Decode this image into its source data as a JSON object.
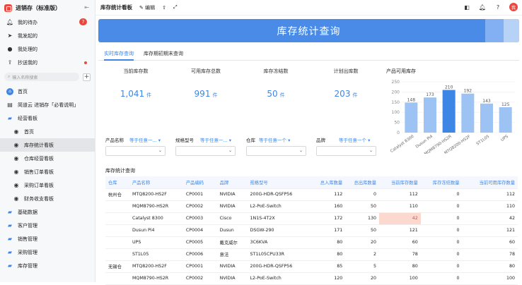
{
  "sidebar": {
    "brand": "进销存（标准版）",
    "items": [
      {
        "label": "我的待办",
        "badge": "7"
      },
      {
        "label": "我发起的"
      },
      {
        "label": "我处理的"
      },
      {
        "label": "抄送我的"
      }
    ],
    "search_placeholder": "输入名称搜索",
    "tree": {
      "home": "首页",
      "guide": "简道云 进销存「必看说明」",
      "board": "经营看板",
      "board_children": [
        "首页",
        "库存统计看板",
        "仓库经营看板",
        "销售订单看板",
        "采购订单看板",
        "财务收支看板"
      ],
      "folders": [
        "基础数据",
        "客户管理",
        "销售管理",
        "采购管理",
        "库存管理"
      ]
    }
  },
  "topbar": {
    "title": "库存统计看板",
    "edit": "编辑"
  },
  "banner": {
    "title": "库存统计查询"
  },
  "tabs": [
    "实时库存查询",
    "库存期初期末查询"
  ],
  "kpis": [
    {
      "label": "当前库存数",
      "value": "1,041",
      "unit": "件"
    },
    {
      "label": "可用库存总数",
      "value": "991",
      "unit": "件"
    },
    {
      "label": "库存冻结数",
      "value": "50",
      "unit": "件"
    },
    {
      "label": "计划出库数",
      "value": "203",
      "unit": "件"
    }
  ],
  "chart_title": "产品可用库存",
  "chart_data": {
    "type": "bar",
    "categories": [
      "Catalyst 8300",
      "Dusun Pi4",
      "MQM8790-HS2R",
      "MTQ8200-HS2F",
      "ST1L05",
      "UPS"
    ],
    "values": [
      148,
      173,
      210,
      192,
      143,
      125
    ],
    "ylim": [
      0,
      250
    ],
    "yticks": [
      0,
      50,
      100,
      150,
      200,
      250
    ],
    "highlight_index": 2,
    "colors": {
      "normal": "#9cc3f3",
      "highlight": "#3d86e6"
    }
  },
  "filters": [
    {
      "label": "产品名称",
      "op": "等于任意一..."
    },
    {
      "label": "规格型号",
      "op": "等于任意一..."
    },
    {
      "label": "仓库",
      "op": "等于任意一个"
    },
    {
      "label": "品牌",
      "op": "等于任意一个"
    }
  ],
  "table": {
    "title": "库存统计查询",
    "headers": [
      "仓库",
      "产品名称",
      "产品编码",
      "品牌",
      "规格型号",
      "总入库数量",
      "总出库数量",
      "当前库存数量",
      "库存冻结数量",
      "当前可用库存数量"
    ],
    "rows": [
      [
        "杭州仓",
        "MTQ8200-HS2F",
        "CP0001",
        "NVIDIA",
        "200G-HDR-QSFP56",
        "112",
        "0",
        "112",
        "0",
        "112"
      ],
      [
        "",
        "MQM8790-HS2R",
        "CP0002",
        "NVIDIA",
        "L2-PoE-Switch",
        "160",
        "50",
        "110",
        "0",
        "110"
      ],
      [
        "",
        "Catalyst 8300",
        "CP0003",
        "Cisco",
        "1N1S-4T2X",
        "172",
        "130",
        "42",
        "0",
        "42"
      ],
      [
        "",
        "Dusun Pi4",
        "CP0004",
        "Dusun",
        "DSGW-290",
        "171",
        "50",
        "121",
        "0",
        "121"
      ],
      [
        "",
        "UPS",
        "CP0005",
        "戴克威尔",
        "3C6KVA",
        "80",
        "20",
        "60",
        "0",
        "60"
      ],
      [
        "",
        "ST1L05",
        "CP0006",
        "意法",
        "ST1L05CPU33R",
        "80",
        "2",
        "78",
        "0",
        "78"
      ],
      [
        "无锡仓",
        "MTQ8200-HS2F",
        "CP0001",
        "NVIDIA",
        "200G-HDR-QSFP56",
        "85",
        "5",
        "80",
        "0",
        "80"
      ],
      [
        "",
        "MQM8790-HS2R",
        "CP0002",
        "NVIDIA",
        "L2-PoE-Switch",
        "120",
        "20",
        "100",
        "0",
        "100"
      ]
    ]
  }
}
